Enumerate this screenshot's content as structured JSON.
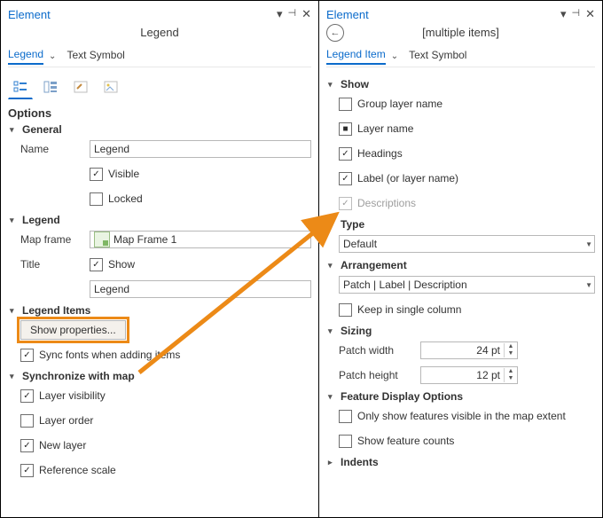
{
  "left": {
    "title": "Element",
    "subtitle": "Legend",
    "tabs": {
      "legend": "Legend",
      "textsymbol": "Text Symbol"
    },
    "optionsHeading": "Options",
    "general": {
      "heading": "General",
      "nameLabel": "Name",
      "nameValue": "Legend",
      "visible": "Visible",
      "locked": "Locked"
    },
    "legend": {
      "heading": "Legend",
      "mapframeLabel": "Map frame",
      "mapframeValue": "Map Frame 1",
      "titleLabel": "Title",
      "show": "Show",
      "titleValue": "Legend"
    },
    "items": {
      "heading": "Legend Items",
      "showProps": "Show properties...",
      "syncFonts": "Sync fonts when adding items"
    },
    "sync": {
      "heading": "Synchronize with map",
      "layerVisibility": "Layer visibility",
      "layerOrder": "Layer order",
      "newLayer": "New layer",
      "referenceScale": "Reference scale"
    }
  },
  "right": {
    "title": "Element",
    "subtitle": "[multiple items]",
    "tabs": {
      "legenditem": "Legend Item",
      "textsymbol": "Text Symbol"
    },
    "show": {
      "heading": "Show",
      "groupLayer": "Group layer name",
      "layerName": "Layer name",
      "headings": "Headings",
      "label": "Label (or layer name)",
      "descriptions": "Descriptions"
    },
    "type": {
      "heading": "Type",
      "value": "Default"
    },
    "arrangement": {
      "heading": "Arrangement",
      "value": "Patch | Label | Description",
      "keepSingle": "Keep in single column"
    },
    "sizing": {
      "heading": "Sizing",
      "patchWidthLabel": "Patch width",
      "patchWidthValue": "24 pt",
      "patchHeightLabel": "Patch height",
      "patchHeightValue": "12 pt"
    },
    "featureDisplay": {
      "heading": "Feature Display Options",
      "onlyVisible": "Only show features visible in the map extent",
      "showCounts": "Show feature counts"
    },
    "indents": {
      "heading": "Indents"
    }
  }
}
